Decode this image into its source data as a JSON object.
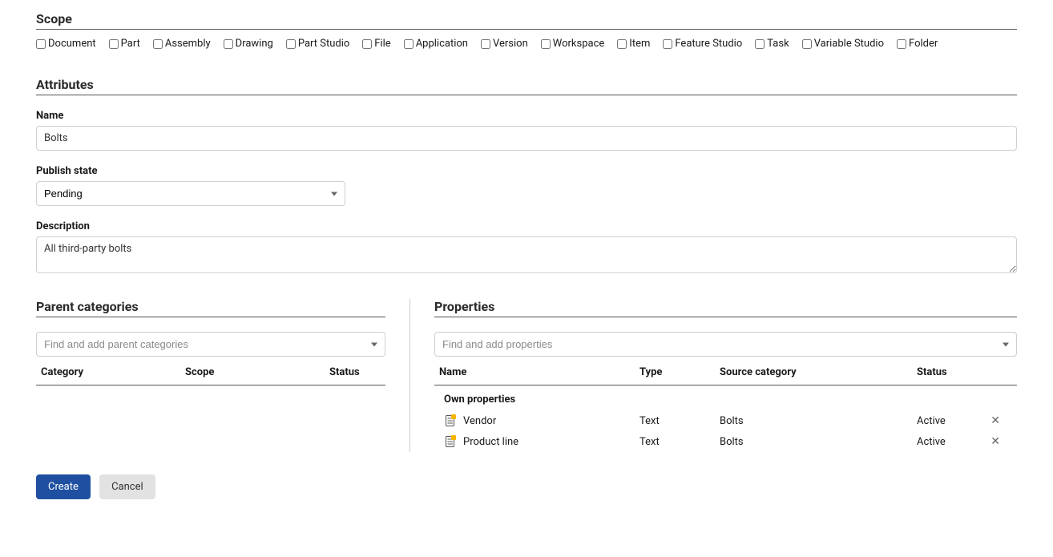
{
  "scope": {
    "title": "Scope",
    "options": [
      {
        "label": "Document",
        "checked": false
      },
      {
        "label": "Part",
        "checked": false
      },
      {
        "label": "Assembly",
        "checked": false
      },
      {
        "label": "Drawing",
        "checked": false
      },
      {
        "label": "Part Studio",
        "checked": false
      },
      {
        "label": "File",
        "checked": false
      },
      {
        "label": "Application",
        "checked": false
      },
      {
        "label": "Version",
        "checked": false
      },
      {
        "label": "Workspace",
        "checked": false
      },
      {
        "label": "Item",
        "checked": false
      },
      {
        "label": "Feature Studio",
        "checked": false
      },
      {
        "label": "Task",
        "checked": false
      },
      {
        "label": "Variable Studio",
        "checked": false
      },
      {
        "label": "Folder",
        "checked": false
      }
    ]
  },
  "attributes": {
    "title": "Attributes",
    "name_label": "Name",
    "name_value": "Bolts",
    "publish_label": "Publish state",
    "publish_value": "Pending",
    "description_label": "Description",
    "description_value": "All third-party bolts"
  },
  "parent_categories": {
    "title": "Parent categories",
    "search_placeholder": "Find and add parent categories",
    "headers": {
      "category": "Category",
      "scope": "Scope",
      "status": "Status"
    }
  },
  "properties": {
    "title": "Properties",
    "search_placeholder": "Find and add properties",
    "headers": {
      "name": "Name",
      "type": "Type",
      "source": "Source category",
      "status": "Status"
    },
    "group_label": "Own properties",
    "rows": [
      {
        "name": "Vendor",
        "type": "Text",
        "source": "Bolts",
        "status": "Active"
      },
      {
        "name": "Product line",
        "type": "Text",
        "source": "Bolts",
        "status": "Active"
      }
    ]
  },
  "actions": {
    "create": "Create",
    "cancel": "Cancel"
  }
}
